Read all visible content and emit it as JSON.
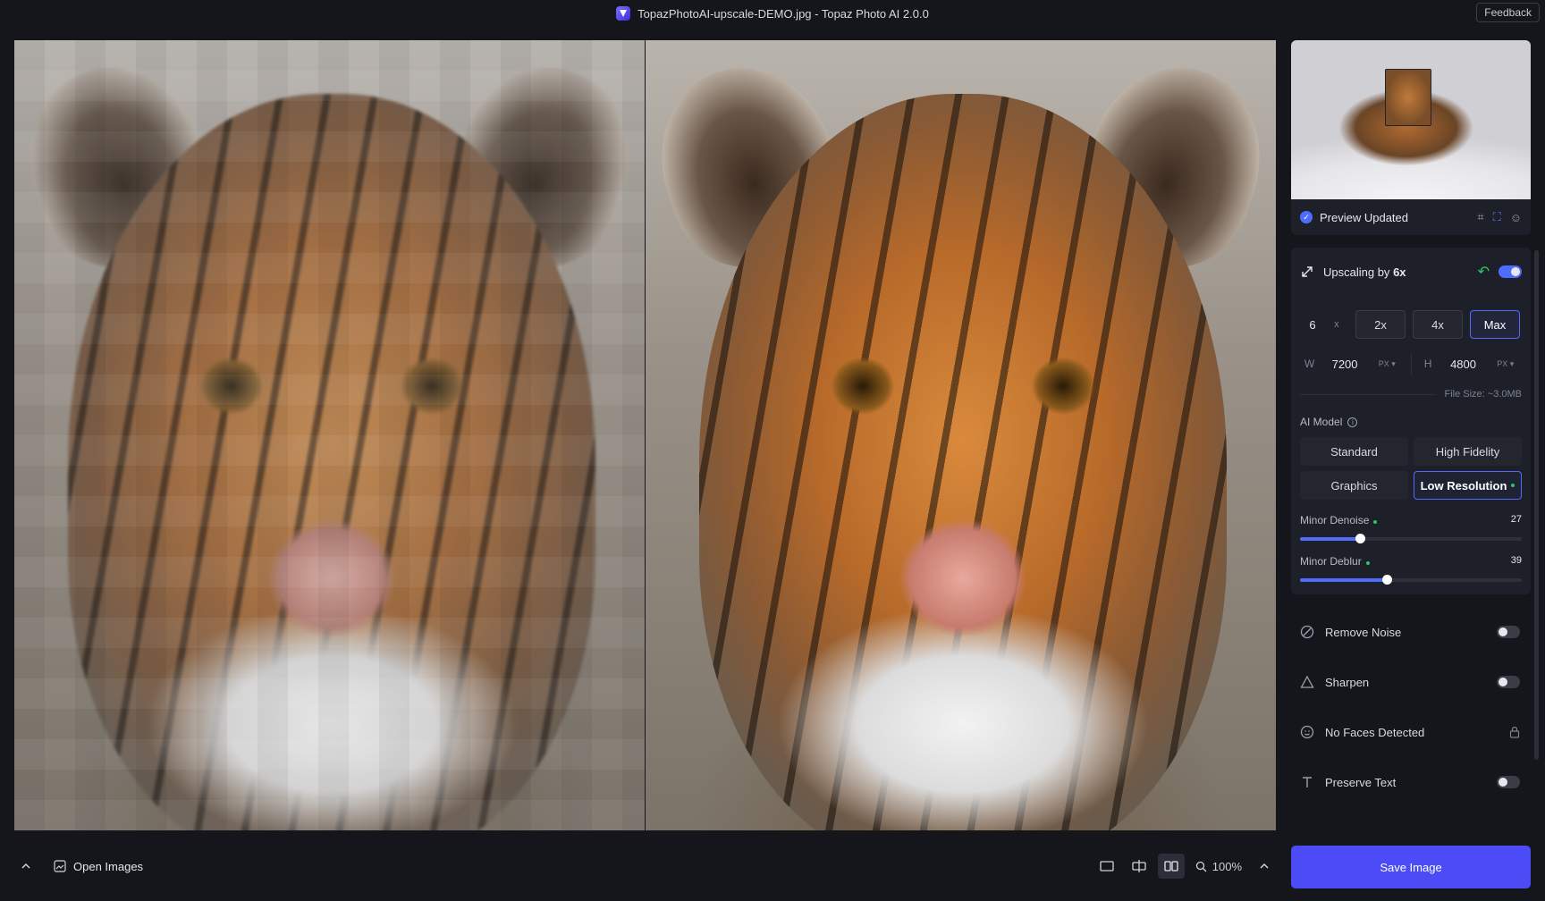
{
  "titlebar": {
    "title": "TopazPhotoAI-upscale-DEMO.jpg - Topaz Photo AI 2.0.0",
    "feedback_label": "Feedback"
  },
  "bottombar": {
    "open_images_label": "Open Images",
    "zoom_label": "100%"
  },
  "panel": {
    "preview_status": "Preview Updated",
    "upscale": {
      "title_prefix": "Upscaling by",
      "title_value": "6x",
      "enabled": true,
      "scale_input": "6",
      "scale_suffix": "x",
      "scale_options": [
        "2x",
        "4x",
        "Max"
      ],
      "selected_option": "Max",
      "width_label": "W",
      "width_value": "7200",
      "width_unit": "PX ▾",
      "height_label": "H",
      "height_value": "4800",
      "height_unit": "PX ▾",
      "file_size": "File Size: ~3.0MB"
    },
    "ai_model": {
      "label": "AI Model",
      "options": [
        "Standard",
        "High Fidelity",
        "Graphics",
        "Low Resolution"
      ],
      "selected": "Low Resolution"
    },
    "sliders": [
      {
        "label": "Minor Denoise",
        "value": "27",
        "percent": 27
      },
      {
        "label": "Minor Deblur",
        "value": "39",
        "percent": 39
      }
    ],
    "features": [
      {
        "label": "Remove Noise",
        "icon": "remove-noise-icon",
        "enabled": false
      },
      {
        "label": "Sharpen",
        "icon": "sharpen-icon",
        "enabled": false
      },
      {
        "label": "No Faces Detected",
        "icon": "face-icon",
        "locked": true
      },
      {
        "label": "Preserve Text",
        "icon": "text-icon",
        "enabled": false
      }
    ],
    "save_label": "Save Image"
  },
  "colors": {
    "accent": "#4f6cff",
    "save_button": "#4b4cf5",
    "active_dot": "#2fc46a",
    "background": "#14161c"
  }
}
